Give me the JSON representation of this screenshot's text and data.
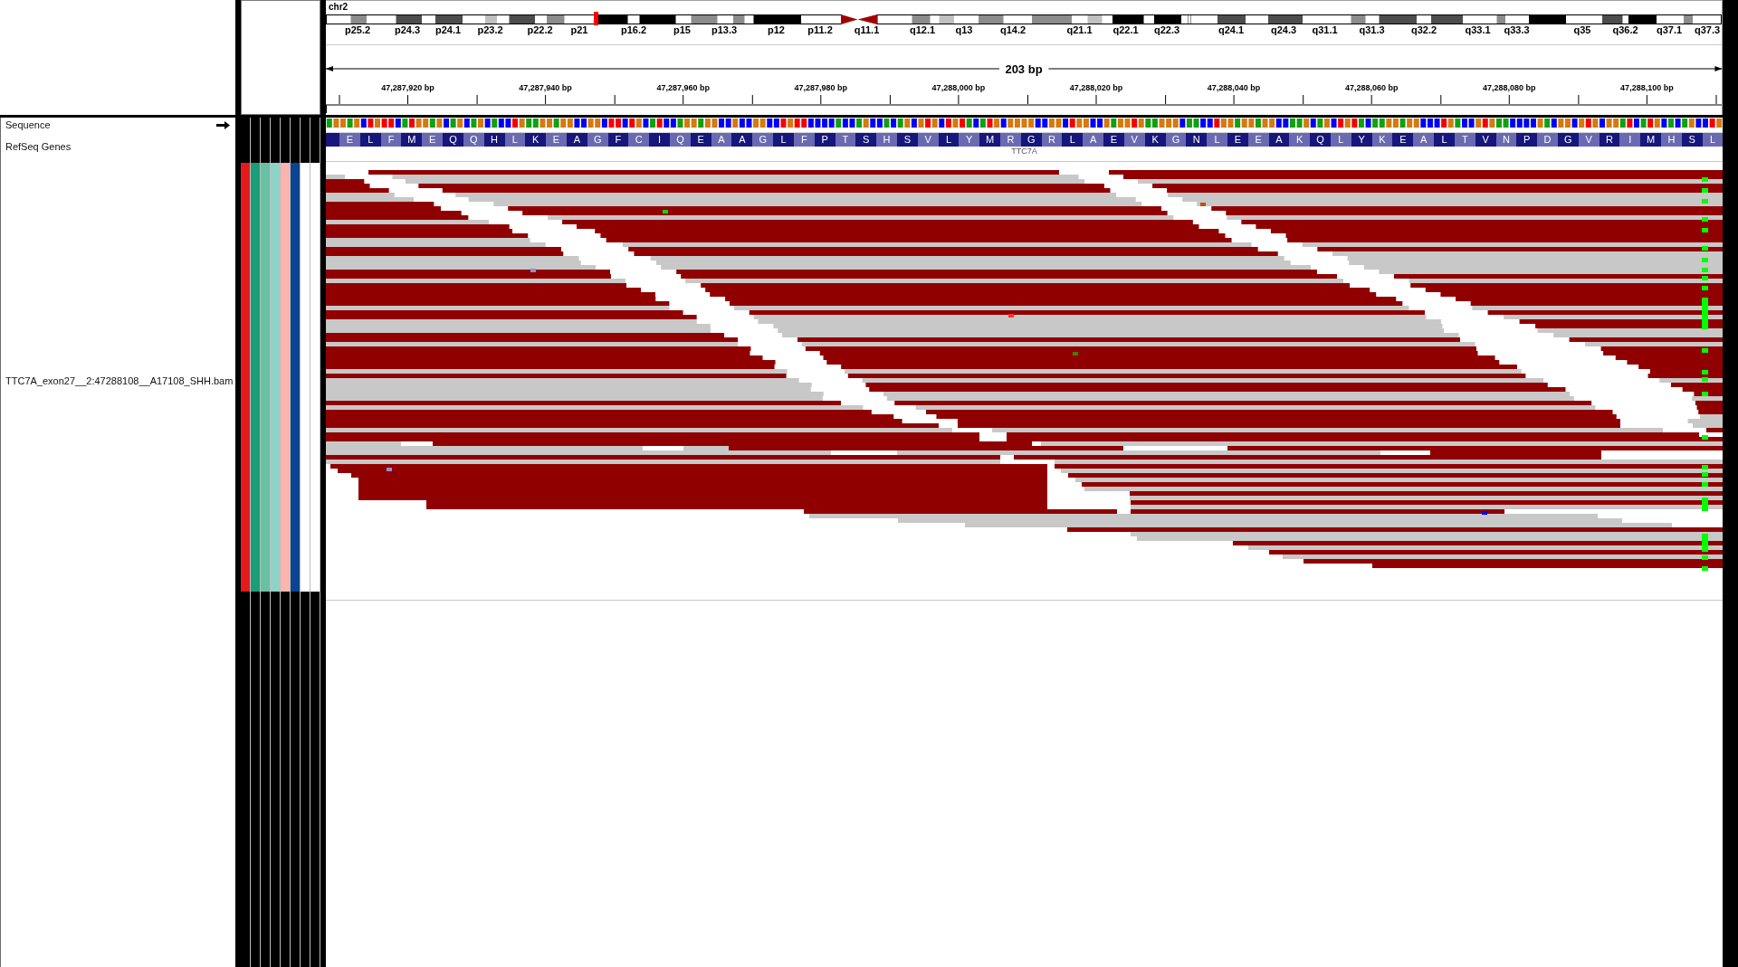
{
  "header": {
    "chromosome": "chr2",
    "cytobands": [
      "p25.2",
      "p24.3",
      "p24.1",
      "p23.2",
      "p22.2",
      "p21",
      "p16.2",
      "p15",
      "p13.3",
      "p12",
      "p11.2",
      "q11.1",
      "q12.1",
      "q13",
      "q14.2",
      "q21.1",
      "q22.1",
      "q22.3",
      "q24.1",
      "q24.3",
      "q31.1",
      "q31.3",
      "q32.2",
      "q33.1",
      "q33.3",
      "q35",
      "q36.2",
      "q37.1",
      "q37.3"
    ],
    "ruler": {
      "span": "203 bp",
      "ticks": [
        "47,287,920 bp",
        "47,287,940 bp",
        "47,287,960 bp",
        "47,287,980 bp",
        "47,288,000 bp",
        "47,288,020 bp",
        "47,288,040 bp",
        "47,288,060 bp",
        "47,288,080 bp",
        "47,288,100 bp"
      ]
    }
  },
  "tracks": [
    {
      "kind": "sequence",
      "name": "Sequence",
      "forward": true
    },
    {
      "kind": "gene",
      "name": "RefSeq Genes",
      "gene": "TTC7A",
      "amino_acids": [
        "E",
        "L",
        "F",
        "M",
        "E",
        "Q",
        "Q",
        "H",
        "L",
        "K",
        "E",
        "A",
        "G",
        "F",
        "C",
        "I",
        "Q",
        "E",
        "A",
        "A",
        "G",
        "L",
        "F",
        "P",
        "T",
        "S",
        "H",
        "S",
        "V",
        "L",
        "Y",
        "M",
        "R",
        "G",
        "R",
        "L",
        "A",
        "E",
        "V",
        "K",
        "G",
        "N",
        "L",
        "E",
        "E",
        "A",
        "K",
        "Q",
        "L",
        "Y",
        "K",
        "E",
        "A",
        "L",
        "T",
        "V",
        "N",
        "P",
        "D",
        "G",
        "V",
        "R",
        "I",
        "M",
        "H",
        "S",
        "L"
      ]
    },
    {
      "kind": "alignment",
      "name": "TTC7A_exon27__2:47288108__A17108_SHH.bam",
      "attributes": [
        {
          "color": "#e41a1c"
        },
        {
          "color": "#1b9e77"
        },
        {
          "color": "#66c2a5"
        },
        {
          "color": "#8dd3c7"
        },
        {
          "color": "#fbb4ae"
        },
        {
          "color": "#0b4592"
        },
        {
          "color": "#ffffff"
        },
        {
          "color": "#ffffff"
        }
      ]
    }
  ]
}
